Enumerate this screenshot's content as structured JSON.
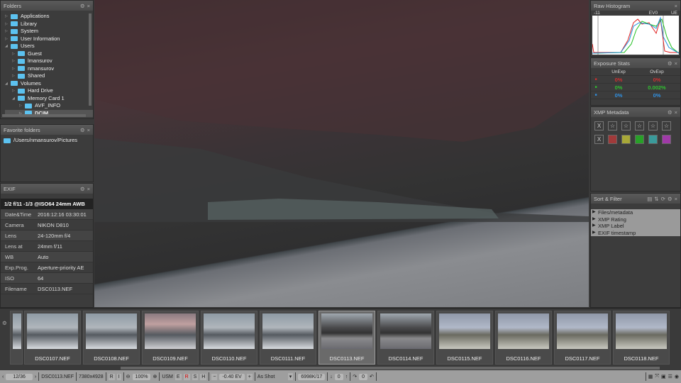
{
  "folders": {
    "title": "Folders",
    "items": [
      {
        "label": "Applications",
        "level": 0,
        "open": false
      },
      {
        "label": "Library",
        "level": 0,
        "open": false
      },
      {
        "label": "System",
        "level": 0,
        "open": false
      },
      {
        "label": "User Information",
        "level": 0,
        "open": false
      },
      {
        "label": "Users",
        "level": 0,
        "open": true
      },
      {
        "label": "Guest",
        "level": 1,
        "open": false
      },
      {
        "label": "lmansurov",
        "level": 1,
        "open": false
      },
      {
        "label": "nmansurov",
        "level": 1,
        "open": false
      },
      {
        "label": "Shared",
        "level": 1,
        "open": false
      },
      {
        "label": "Volumes",
        "level": 0,
        "open": true
      },
      {
        "label": "Hard Drive",
        "level": 1,
        "open": false
      },
      {
        "label": "Memory Card 1",
        "level": 1,
        "open": true
      },
      {
        "label": "AVF_INFO",
        "level": 2,
        "open": false
      },
      {
        "label": "DCIM",
        "level": 2,
        "open": false,
        "selected": true
      }
    ]
  },
  "favorites": {
    "title": "Favorite folders",
    "items": [
      "/Users/nmansurov/Pictures"
    ]
  },
  "exif": {
    "title": "EXIF",
    "summary": "1/2 f/11 -1/3 @ISO64 24mm AWB",
    "rows": [
      [
        "Date&Time",
        "2016:12:16 03:30:01"
      ],
      [
        "Camera",
        "NIKON D810"
      ],
      [
        "Lens",
        "24-120mm f/4"
      ],
      [
        "Lens at",
        "24mm f/11"
      ],
      [
        "WB",
        "Auto"
      ],
      [
        "Exp.Prog.",
        "Aperture-priority AE"
      ],
      [
        "ISO",
        "64"
      ],
      [
        "Filename",
        "DSC0113.NEF"
      ]
    ]
  },
  "histogram": {
    "title": "Raw Histogram",
    "labels": [
      "-11",
      "EV0",
      "UE"
    ]
  },
  "exposure": {
    "title": "Exposure Stats",
    "headers": [
      "UnExp",
      "OvExp"
    ],
    "rows": [
      {
        "ch": "R",
        "un": "0%",
        "ov": "0%",
        "color": "#d03030"
      },
      {
        "ch": "G",
        "un": "0%",
        "ov": "0.002%",
        "color": "#30c030"
      },
      {
        "ch": "B",
        "un": "0%",
        "ov": "0%",
        "color": "#3090e0"
      }
    ]
  },
  "xmp": {
    "title": "XMP Metadata",
    "reject": "X",
    "label_colors": [
      "#a03a3a",
      "#a8a838",
      "#28a028",
      "#3a9a9a",
      "#a03aa8"
    ]
  },
  "sort": {
    "title": "Sort & Filter",
    "items": [
      "Files/metadata",
      "XMP Rating",
      "XMP Label",
      "EXIF timestamp"
    ]
  },
  "filmstrip": [
    {
      "name": "DSC0107.NEF",
      "tone": "snow"
    },
    {
      "name": "DSC0108.NEF",
      "tone": "snow"
    },
    {
      "name": "DSC0109.NEF",
      "tone": "snowpink"
    },
    {
      "name": "DSC0110.NEF",
      "tone": "snow"
    },
    {
      "name": "DSC0111.NEF",
      "tone": "snow"
    },
    {
      "name": "DSC0113.NEF",
      "tone": "lake",
      "selected": true
    },
    {
      "name": "DSC0114.NEF",
      "tone": "lake"
    },
    {
      "name": "DSC0115.NEF",
      "tone": "rock"
    },
    {
      "name": "DSC0116.NEF",
      "tone": "rock"
    },
    {
      "name": "DSC0117.NEF",
      "tone": "rock"
    },
    {
      "name": "DSC0118.NEF",
      "tone": "rock"
    }
  ],
  "status": {
    "counter": "12/36",
    "filename": "DSC0113.NEF",
    "dimensions": "7380x4928",
    "r": "R",
    "i": "I",
    "zoom": "100%",
    "usm": "USM",
    "e": "E",
    "red": "R",
    "s": "S",
    "h": "H",
    "ev": "-0.40 EV",
    "wb": "As Shot",
    "cache": "6998K/17",
    "rating": "0",
    "rotate": "0"
  }
}
